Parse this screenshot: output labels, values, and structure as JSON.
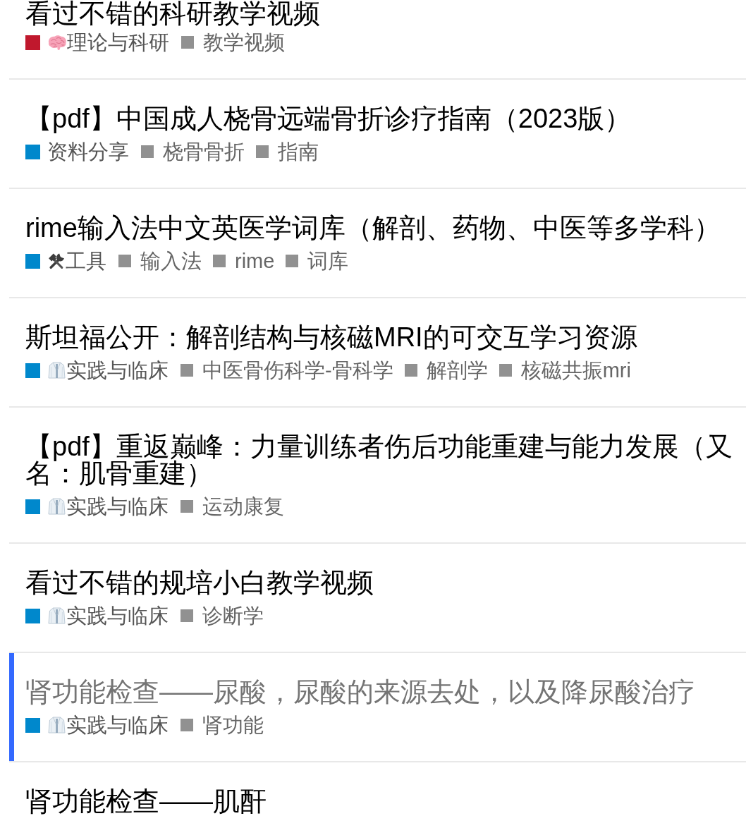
{
  "topics": [
    {
      "title": "看过不错的科研教学视频",
      "visited": false,
      "selected": false,
      "category": {
        "name": "理论与科研",
        "kind": "brain",
        "color": "#c0182d"
      },
      "tags": [
        "教学视频"
      ]
    },
    {
      "title": "【pdf】中国成人桡骨远端骨折诊疗指南（2023版）",
      "visited": false,
      "selected": false,
      "category": {
        "name": "资料分享",
        "kind": "plain",
        "color": "#0088cc"
      },
      "tags": [
        "桡骨骨折",
        "指南"
      ]
    },
    {
      "title": "rime输入法中文英医学词库（解剖、药物、中医等多学科）",
      "visited": false,
      "selected": false,
      "category": {
        "name": "工具",
        "kind": "tools",
        "color": "#0088cc"
      },
      "tags": [
        "输入法",
        "rime",
        "词库"
      ]
    },
    {
      "title": "斯坦福公开：解剖结构与核磁MRI的可交互学习资源",
      "visited": false,
      "selected": false,
      "category": {
        "name": "实践与临床",
        "kind": "coat",
        "color": "#0088cc"
      },
      "tags": [
        "中医骨伤科学-骨科学",
        "解剖学",
        "核磁共振mri"
      ]
    },
    {
      "title": "【pdf】重返巅峰：力量训练者伤后功能重建与能力发展（又名：肌骨重建）",
      "visited": false,
      "selected": false,
      "category": {
        "name": "实践与临床",
        "kind": "coat",
        "color": "#0088cc"
      },
      "tags": [
        "运动康复"
      ]
    },
    {
      "title": "看过不错的规培小白教学视频",
      "visited": false,
      "selected": false,
      "category": {
        "name": "实践与临床",
        "kind": "coat",
        "color": "#0088cc"
      },
      "tags": [
        "诊断学"
      ]
    },
    {
      "title": "肾功能检查——尿酸，尿酸的来源去处，以及降尿酸治疗",
      "visited": true,
      "selected": true,
      "category": {
        "name": "实践与临床",
        "kind": "coat",
        "color": "#0088cc"
      },
      "tags": [
        "肾功能"
      ]
    },
    {
      "title": "肾功能检查——肌酐",
      "visited": false,
      "selected": false
    }
  ]
}
